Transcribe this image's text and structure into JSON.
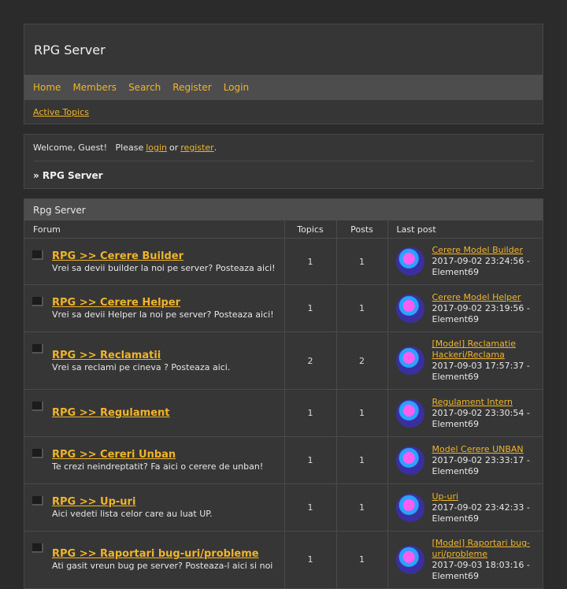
{
  "site": {
    "title": "RPG Server"
  },
  "nav": [
    "Home",
    "Members",
    "Search",
    "Register",
    "Login"
  ],
  "subnav": {
    "active_topics": "Active Topics"
  },
  "welcome": {
    "prefix": "Welcome, Guest!   Please",
    "login": "login",
    "or": "or",
    "register": "register",
    "suffix": "."
  },
  "breadcrumb": "» RPG Server",
  "category": {
    "title": "Rpg Server",
    "columns": {
      "forum": "Forum",
      "topics": "Topics",
      "posts": "Posts",
      "last_post": "Last post"
    }
  },
  "forums": [
    {
      "name": "RPG >> Cerere Builder",
      "desc": "Vrei sa devii builder la noi pe server? Posteaza aici!",
      "topics": "1",
      "posts": "1",
      "last_title": "Cerere Model Builder",
      "last_date": "2017-09-02 23:24:56 -",
      "last_user": "Element69"
    },
    {
      "name": "RPG >> Cerere Helper",
      "desc": "Vrei sa devii Helper la noi pe server? Posteaza aici!",
      "topics": "1",
      "posts": "1",
      "last_title": "Cerere Model Helper",
      "last_date": "2017-09-02 23:19:56 -",
      "last_user": "Element69"
    },
    {
      "name": "RPG >> Reclamatii",
      "desc": "Vrei sa reclami pe cineva ? Posteaza aici.",
      "topics": "2",
      "posts": "2",
      "last_title": "[Model] Reclamatie Hackeri/Reclama",
      "last_date": "2017-09-03 17:57:37 -",
      "last_user": "Element69"
    },
    {
      "name": "RPG >> Regulament",
      "desc": "",
      "topics": "1",
      "posts": "1",
      "last_title": "Regulament Intern",
      "last_date": "2017-09-02 23:30:54 -",
      "last_user": "Element69"
    },
    {
      "name": "RPG >> Cereri Unban",
      "desc": "Te crezi neindreptatit? Fa aici o cerere de unban!",
      "topics": "1",
      "posts": "1",
      "last_title": "Model Cerere UNBAN",
      "last_date": "2017-09-02 23:33:17 -",
      "last_user": "Element69"
    },
    {
      "name": "RPG >> Up-uri",
      "desc": "Aici vedeti lista celor care au luat UP.",
      "topics": "1",
      "posts": "1",
      "last_title": "Up-uri",
      "last_date": "2017-09-02 23:42:33 -",
      "last_user": "Element69"
    },
    {
      "name": "RPG >> Raportari bug-uri/probleme",
      "desc": "Ati gasit vreun bug pe server? Posteaza-l aici si noi",
      "topics": "1",
      "posts": "1",
      "last_title": "[Model] Raportari bug-uri/probleme",
      "last_date": "2017-09-03 18:03:16 -",
      "last_user": "Element69"
    }
  ]
}
